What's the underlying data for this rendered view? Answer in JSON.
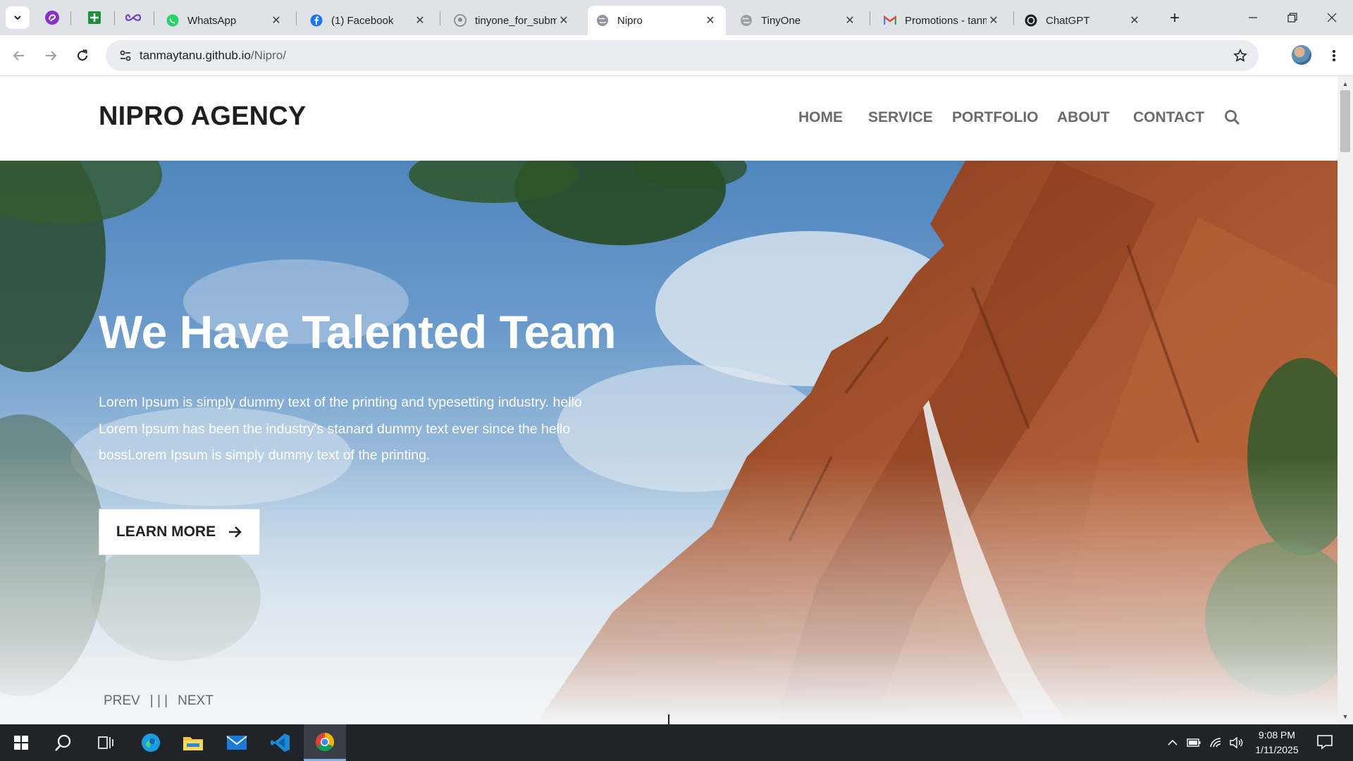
{
  "browser": {
    "tabs": [
      {
        "title": "WhatsApp"
      },
      {
        "title": "(1) Facebook"
      },
      {
        "title": "tinyone_for_submission"
      },
      {
        "title": "Nipro",
        "active": true
      },
      {
        "title": "TinyOne"
      },
      {
        "title": "Promotions - tanmaytanu"
      },
      {
        "title": "ChatGPT"
      }
    ],
    "url_host": "tanmaytanu.github.io",
    "url_path": "/Nipro/"
  },
  "site": {
    "logo": "NIPRO AGENCY",
    "menu": [
      "HOME",
      "SERVICE",
      "PORTFOLIO",
      "ABOUT",
      "CONTACT"
    ],
    "hero": {
      "title": "We Have Talented Team",
      "text": "Lorem Ipsum is simply dummy text of the printing and typesetting industry. hello Lorem Ipsum has been the industry's stanard dummy text ever since the hello bossLorem Ipsum is simply dummy text of the printing.",
      "button": "LEARN MORE",
      "prev": "PREV",
      "divider": "| | |",
      "next": "NEXT"
    }
  },
  "taskbar": {
    "time": "9:08 PM",
    "date": "1/11/2025"
  },
  "colors": {
    "tabstrip": "#dfe3e8",
    "sky": "#6b9bcb",
    "cliff": "#9c4a2a",
    "taskbar": "#202329"
  }
}
